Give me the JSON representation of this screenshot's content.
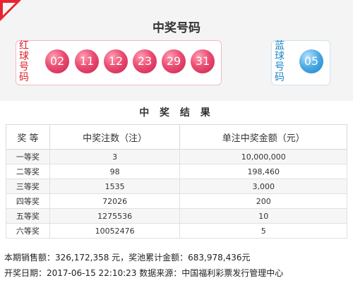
{
  "header": {
    "title": "中奖号码"
  },
  "balls": {
    "red_label": "红球号码",
    "red": [
      "02",
      "11",
      "12",
      "23",
      "29",
      "31"
    ],
    "blue_label": "蓝球号码",
    "blue": [
      "05"
    ]
  },
  "results": {
    "title": "中 奖 结 果",
    "columns": [
      "奖 等",
      "中奖注数（注）",
      "单注中奖金额（元）"
    ],
    "rows": [
      {
        "level": "一等奖",
        "count": "3",
        "amount": "10,000,000"
      },
      {
        "level": "二等奖",
        "count": "98",
        "amount": "198,460"
      },
      {
        "level": "三等奖",
        "count": "1535",
        "amount": "3,000"
      },
      {
        "level": "四等奖",
        "count": "72026",
        "amount": "200"
      },
      {
        "level": "五等奖",
        "count": "1275536",
        "amount": "10"
      },
      {
        "level": "六等奖",
        "count": "10052476",
        "amount": "5"
      }
    ]
  },
  "footer": {
    "sales": "本期销售额：326,172,358 元，奖池累计金额：683,978,436元",
    "draw_info": "开奖日期：2017-06-15 22:10:23 数据来源：中国福利彩票发行管理中心"
  },
  "colors": {
    "accent": "#e8232f",
    "red_ball": "#e23a63",
    "blue_ball": "#2f94d6"
  }
}
